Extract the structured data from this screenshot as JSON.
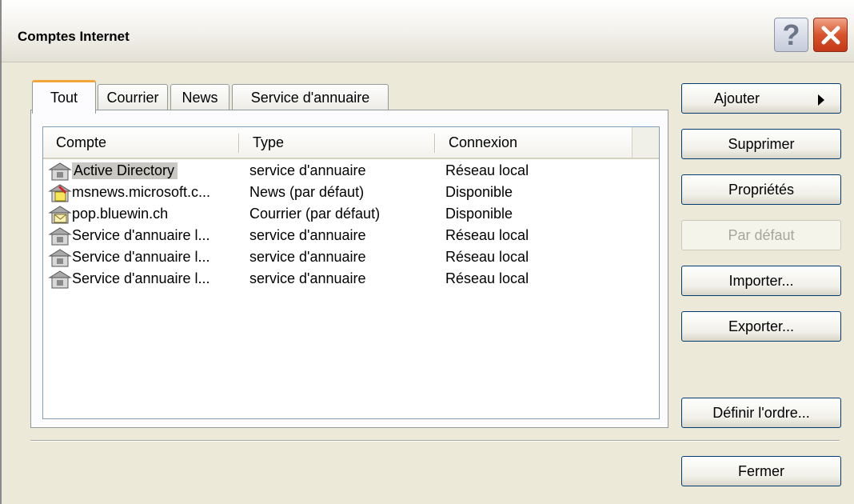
{
  "window": {
    "title": "Comptes Internet",
    "help_label": "?"
  },
  "tabs": [
    {
      "label": "Tout",
      "active": true
    },
    {
      "label": "Courrier",
      "active": false
    },
    {
      "label": "News",
      "active": false
    },
    {
      "label": "Service d'annuaire",
      "active": false
    }
  ],
  "list": {
    "columns": [
      "Compte",
      "Type",
      "Connexion"
    ],
    "rows": [
      {
        "account": "Active Directory",
        "type": "service d'annuaire",
        "connection": "Réseau local",
        "icon": "directory-icon",
        "selected": true
      },
      {
        "account": "msnews.microsoft.c...",
        "type": "News (par défaut)",
        "connection": "Disponible",
        "icon": "news-icon",
        "selected": false
      },
      {
        "account": "pop.bluewin.ch",
        "type": "Courrier (par défaut)",
        "connection": "Disponible",
        "icon": "mail-icon",
        "selected": false
      },
      {
        "account": "Service d'annuaire l...",
        "type": "service d'annuaire",
        "connection": "Réseau local",
        "icon": "directory-icon",
        "selected": false
      },
      {
        "account": "Service d'annuaire l...",
        "type": "service d'annuaire",
        "connection": "Réseau local",
        "icon": "directory-icon",
        "selected": false
      },
      {
        "account": "Service d'annuaire l...",
        "type": "service d'annuaire",
        "connection": "Réseau local",
        "icon": "directory-icon",
        "selected": false
      }
    ]
  },
  "buttons": {
    "add": "Ajouter",
    "remove": "Supprimer",
    "properties": "Propriétés",
    "default": "Par défaut",
    "import": "Importer...",
    "export": "Exporter...",
    "set_order": "Définir l'ordre...",
    "close": "Fermer"
  },
  "colors": {
    "dialog_bg": "#ECE9D8",
    "tab_highlight": "#F2A63A",
    "close_button": "#D8542B",
    "button_border": "#003C74"
  }
}
